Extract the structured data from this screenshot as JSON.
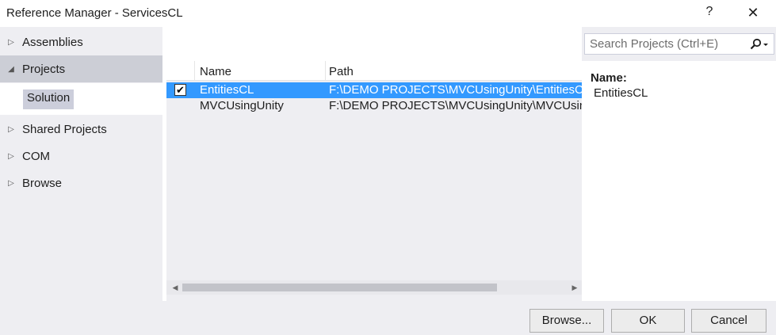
{
  "window": {
    "title": "Reference Manager - ServicesCL",
    "help_label": "?",
    "close_label": "✕"
  },
  "nav": {
    "items": [
      {
        "label": "Assemblies",
        "expanded": false
      },
      {
        "label": "Projects",
        "expanded": true
      },
      {
        "label": "Shared Projects",
        "expanded": false
      },
      {
        "label": "COM",
        "expanded": false
      },
      {
        "label": "Browse",
        "expanded": false
      }
    ],
    "sub_item": "Solution"
  },
  "grid": {
    "columns": {
      "name": "Name",
      "path": "Path"
    },
    "rows": [
      {
        "checked": true,
        "selected": true,
        "name": "EntitiesCL",
        "path": "F:\\DEMO PROJECTS\\MVCUsingUnity\\EntitiesCL\\EntitiesCL.csproj"
      },
      {
        "checked": false,
        "selected": false,
        "name": "MVCUsingUnity",
        "path": "F:\\DEMO PROJECTS\\MVCUsingUnity\\MVCUsingUnity\\MVCUsingUnity.csproj"
      }
    ]
  },
  "search": {
    "placeholder": "Search Projects (Ctrl+E)",
    "value": "",
    "icon": "search-icon"
  },
  "details": {
    "label": "Name:",
    "value": "EntitiesCL"
  },
  "buttons": {
    "browse": "Browse...",
    "ok": "OK",
    "cancel": "Cancel"
  },
  "colors": {
    "selection": "#3399ff",
    "panel_bg": "#eeeef2",
    "nav_selected": "#ccced6"
  }
}
